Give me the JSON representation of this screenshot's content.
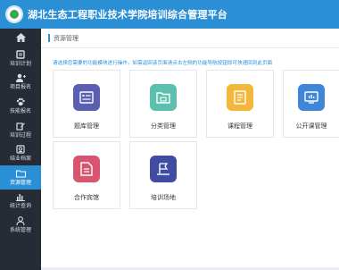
{
  "header": {
    "title": "湖北生态工程职业技术学院培训综合管理平台"
  },
  "sidebar": {
    "items": [
      {
        "label": "",
        "icon": "home-icon"
      },
      {
        "label": "培训计划",
        "icon": "book-icon"
      },
      {
        "label": "项目报名",
        "icon": "user-add-icon"
      },
      {
        "label": "技能报名",
        "icon": "paw-icon"
      },
      {
        "label": "培训过程",
        "icon": "edit-icon"
      },
      {
        "label": "结业档案",
        "icon": "archive-icon"
      },
      {
        "label": "资源管理",
        "icon": "folder-icon",
        "active": true
      },
      {
        "label": "统计查询",
        "icon": "bar-chart-icon"
      },
      {
        "label": "系统管理",
        "icon": "user-icon"
      }
    ]
  },
  "breadcrumb": {
    "current": "资源管理"
  },
  "hint": "请选择您需要的功能模块进行操作，如需返回该页面请点击左侧的功能导航按钮即可快速回到此页面",
  "cards": [
    {
      "label": "题库管理",
      "icon": "question-bank-icon",
      "color": "#5b5fb0"
    },
    {
      "label": "分类管理",
      "icon": "category-icon",
      "color": "#5dbfae"
    },
    {
      "label": "课程管理",
      "icon": "course-icon",
      "color": "#f2b73b"
    },
    {
      "label": "公开课管理",
      "icon": "open-course-icon",
      "color": "#3f86d8"
    },
    {
      "label": "合作宾馆",
      "icon": "hotel-icon",
      "color": "#d9546f"
    },
    {
      "label": "培训场地",
      "icon": "venue-icon",
      "color": "#3f4ca0"
    }
  ],
  "colors": {
    "header": "#2b8fd6",
    "sidebar": "#262c36",
    "active": "#2b8fd6"
  }
}
